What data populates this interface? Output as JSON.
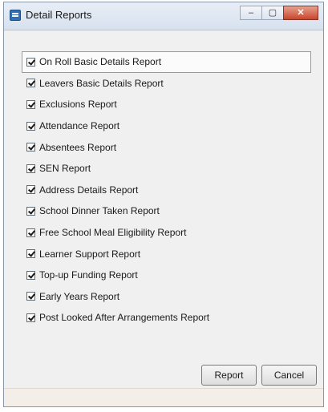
{
  "window": {
    "title": "Detail Reports",
    "controls": {
      "minimize": "–",
      "maximize": "▢",
      "close": "✕"
    }
  },
  "reports": [
    {
      "label": "On Roll Basic Details Report",
      "checked": true,
      "focused": true
    },
    {
      "label": "Leavers Basic Details Report",
      "checked": true
    },
    {
      "label": "Exclusions Report",
      "checked": true
    },
    {
      "label": "Attendance Report",
      "checked": true
    },
    {
      "label": "Absentees Report",
      "checked": true
    },
    {
      "label": "SEN Report",
      "checked": true
    },
    {
      "label": "Address Details Report",
      "checked": true
    },
    {
      "label": "School Dinner Taken Report",
      "checked": true
    },
    {
      "label": "Free School Meal Eligibility Report",
      "checked": true
    },
    {
      "label": "Learner Support Report",
      "checked": true
    },
    {
      "label": "Top-up Funding Report",
      "checked": true
    },
    {
      "label": "Early Years Report",
      "checked": true
    },
    {
      "label": "Post Looked After Arrangements Report",
      "checked": true
    }
  ],
  "buttons": {
    "report": "Report",
    "cancel": "Cancel"
  }
}
